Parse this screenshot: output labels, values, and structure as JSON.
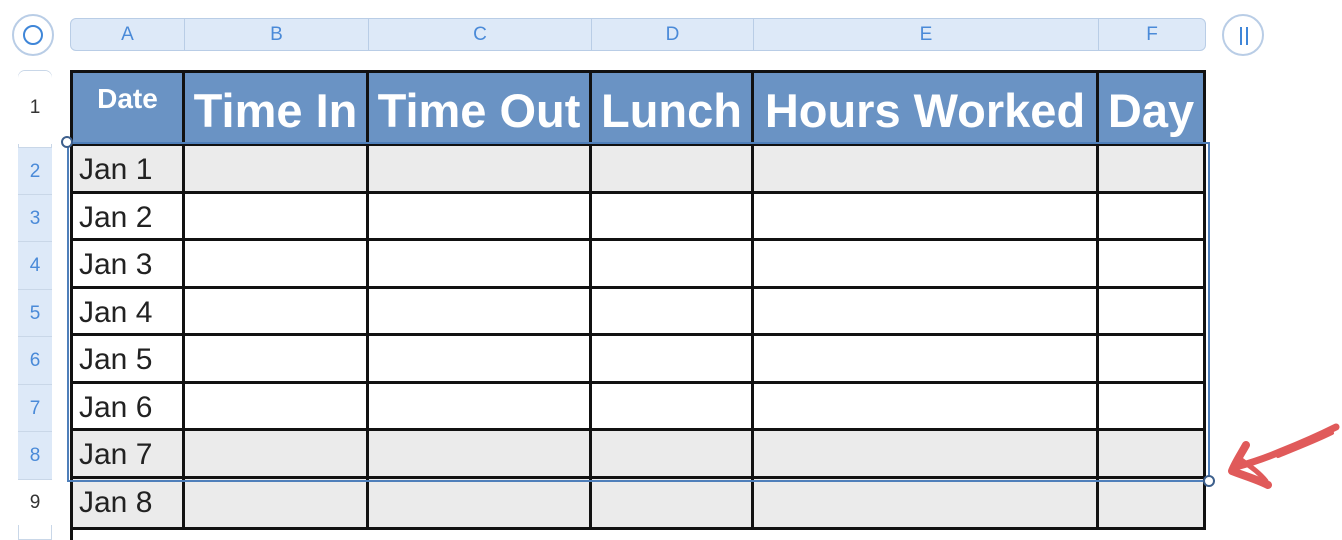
{
  "toolbar": {
    "left_control_icon": "circle-icon",
    "right_control_icon": "pause-icon"
  },
  "columns": [
    "A",
    "B",
    "C",
    "D",
    "E",
    "F"
  ],
  "rows": [
    "1",
    "2",
    "3",
    "4",
    "5",
    "6",
    "7",
    "8",
    "9"
  ],
  "table": {
    "headers": [
      "Date",
      "Time In",
      "Time Out",
      "Lunch",
      "Hours Worked",
      "Day"
    ],
    "dates": [
      "Jan 1",
      "Jan 2",
      "Jan 3",
      "Jan 4",
      "Jan 5",
      "Jan 6",
      "Jan 7",
      "Jan 8"
    ]
  },
  "annotation": {
    "arrow_icon": "hand-drawn-arrow-icon",
    "arrow_color": "#e05a5a"
  },
  "colors": {
    "header_fill": "#6a93c4",
    "selection_stroke": "#4f7fba",
    "accent": "#4a8ad8"
  }
}
